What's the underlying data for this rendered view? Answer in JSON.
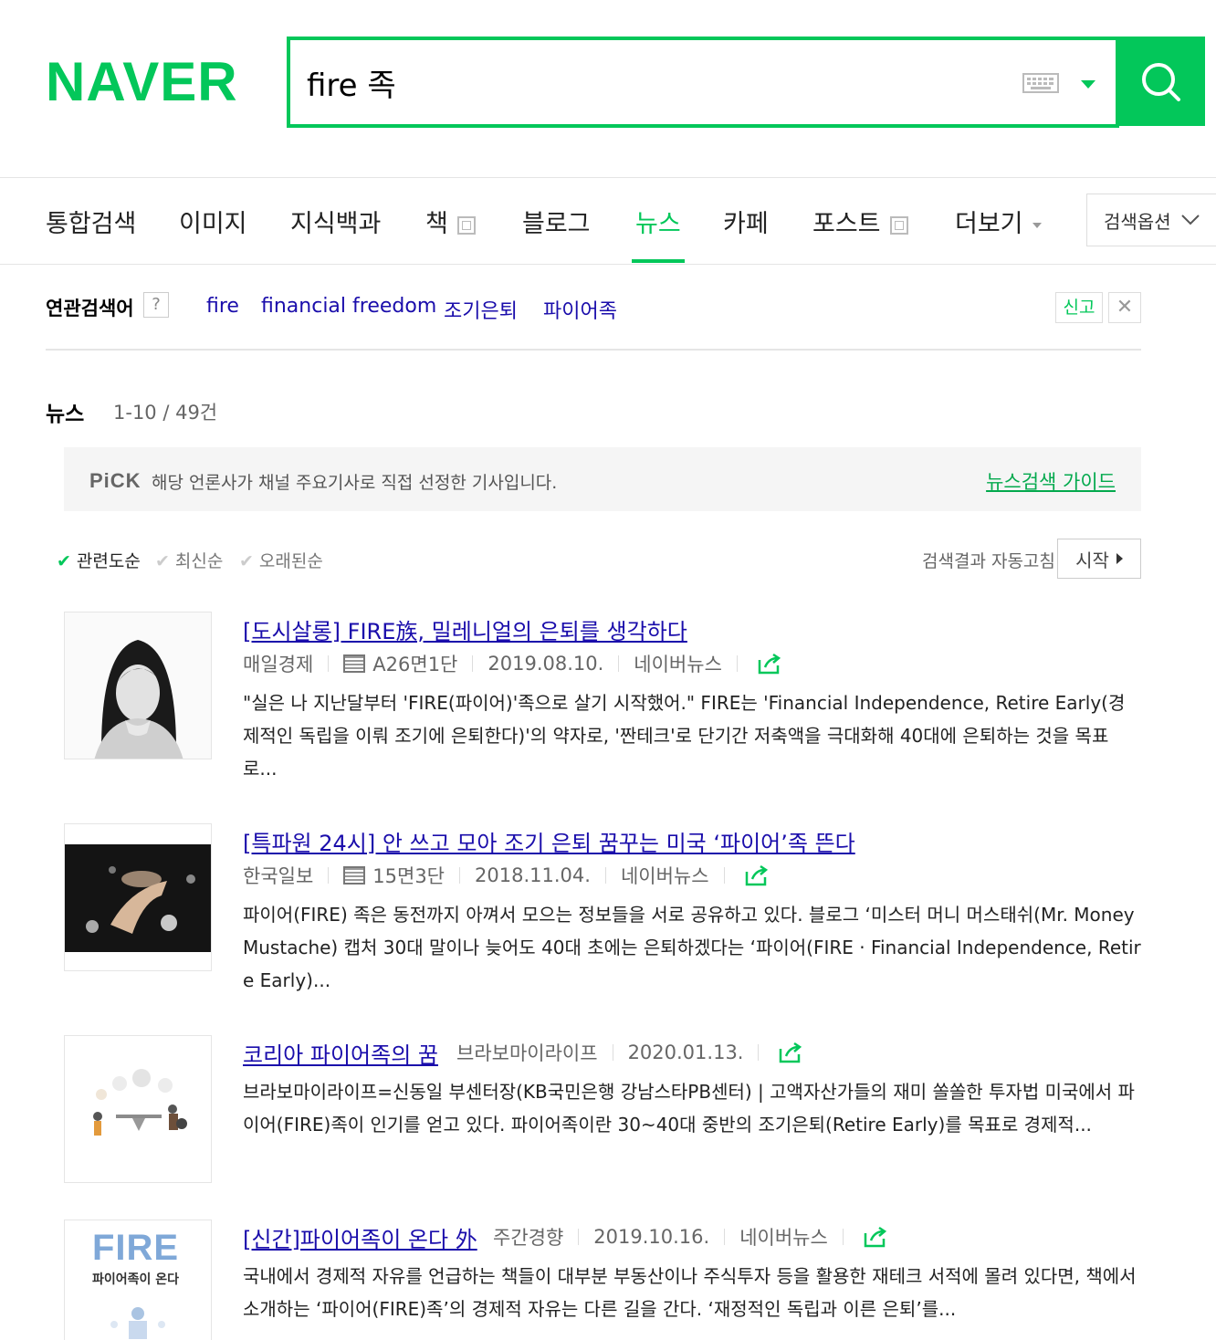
{
  "header": {
    "logo": "NAVER",
    "search_value": "fire 족",
    "colors": {
      "brand": "#03c75a",
      "link": "#1a0dab"
    }
  },
  "tabs": [
    {
      "label": "통합검색"
    },
    {
      "label": "이미지"
    },
    {
      "label": "지식백과"
    },
    {
      "label": "책"
    },
    {
      "label": "블로그"
    },
    {
      "label": "뉴스"
    },
    {
      "label": "카페"
    },
    {
      "label": "포스트"
    },
    {
      "label": "더보기"
    }
  ],
  "search_options": "검색옵션",
  "related": {
    "title": "연관검색어",
    "help": "?",
    "links": [
      "fire",
      "financial freedom",
      "조기은퇴",
      "파이어족"
    ],
    "report": "신고",
    "close": "✕"
  },
  "news": {
    "title": "뉴스",
    "count": "1-10 / 49건",
    "pick_logo": "PiCK",
    "pick_text": "해당 언론사가 채널 주요기사로 직접 선정한 기사입니다.",
    "guide": "뉴스검색 가이드",
    "sort": [
      "관련도순",
      "최신순",
      "오래된순"
    ],
    "sort_check": "✔",
    "auto_refresh_label": "검색결과 자동고침",
    "auto_refresh_start": "시작"
  },
  "items": [
    {
      "title": "[도시살롱] FIRE族, 밀레니얼의 은퇴를 생각하다",
      "source": "매일경제",
      "page": "A26면1단",
      "date": "2019.08.10.",
      "via": "네이버뉴스",
      "snippet": "\"실은 나 지난달부터 'FIRE(파이어)'족으로 살기 시작했어.\" FIRE는 'Financial Independence, Retire Early(경제적인 독립을 이뤄 조기에 은퇴한다)'의 약자로, '짠테크'로 단기간 저축액을 극대화해 40대에 은퇴하는 것을 목표로..."
    },
    {
      "title": "[특파원 24시] 안 쓰고 모아 조기 은퇴 꿈꾸는 미국 ‘파이어’족 뜬다",
      "source": "한국일보",
      "page": "15면3단",
      "date": "2018.11.04.",
      "via": "네이버뉴스",
      "snippet": "파이어(FIRE) 족은 동전까지 아껴서 모으는 정보들을 서로 공유하고 있다. 블로그 ‘미스터 머니 머스태쉬(Mr. Money Mustache) 캡처 30대 말이나 늦어도 40대 초에는 은퇴하겠다는 ‘파이어(FIRE · Financial Independence, Retire Early)..."
    },
    {
      "title": "코리아 파이어족의 꿈",
      "source": "브라보마이라이프",
      "date": "2020.01.13.",
      "snippet": "브라보마이라이프=신동일 부센터장(KB국민은행 강남스타PB센터) | 고액자산가들의 재미 쏠쏠한 투자법 미국에서 파이어(FIRE)족이 인기를 얻고 있다. 파이어족이란 30~40대 중반의 조기은퇴(Retire Early)를 목표로 경제적..."
    },
    {
      "title": "[신간]파이어족이 온다 外",
      "source": "주간경향",
      "date": "2019.10.16.",
      "via": "네이버뉴스",
      "snippet": "국내에서 경제적 자유를 언급하는 책들이 대부분 부동산이나 주식투자 등을 활용한 재테크 서적에 몰려 있다면, 책에서 소개하는 ‘파이어(FIRE)족’의 경제적 자유는 다른 길을 간다. ‘재정적인 독립과 이른 은퇴’를...",
      "book_cover_title": "FIRE",
      "book_cover_subtitle": "파이어족이 온다"
    }
  ]
}
